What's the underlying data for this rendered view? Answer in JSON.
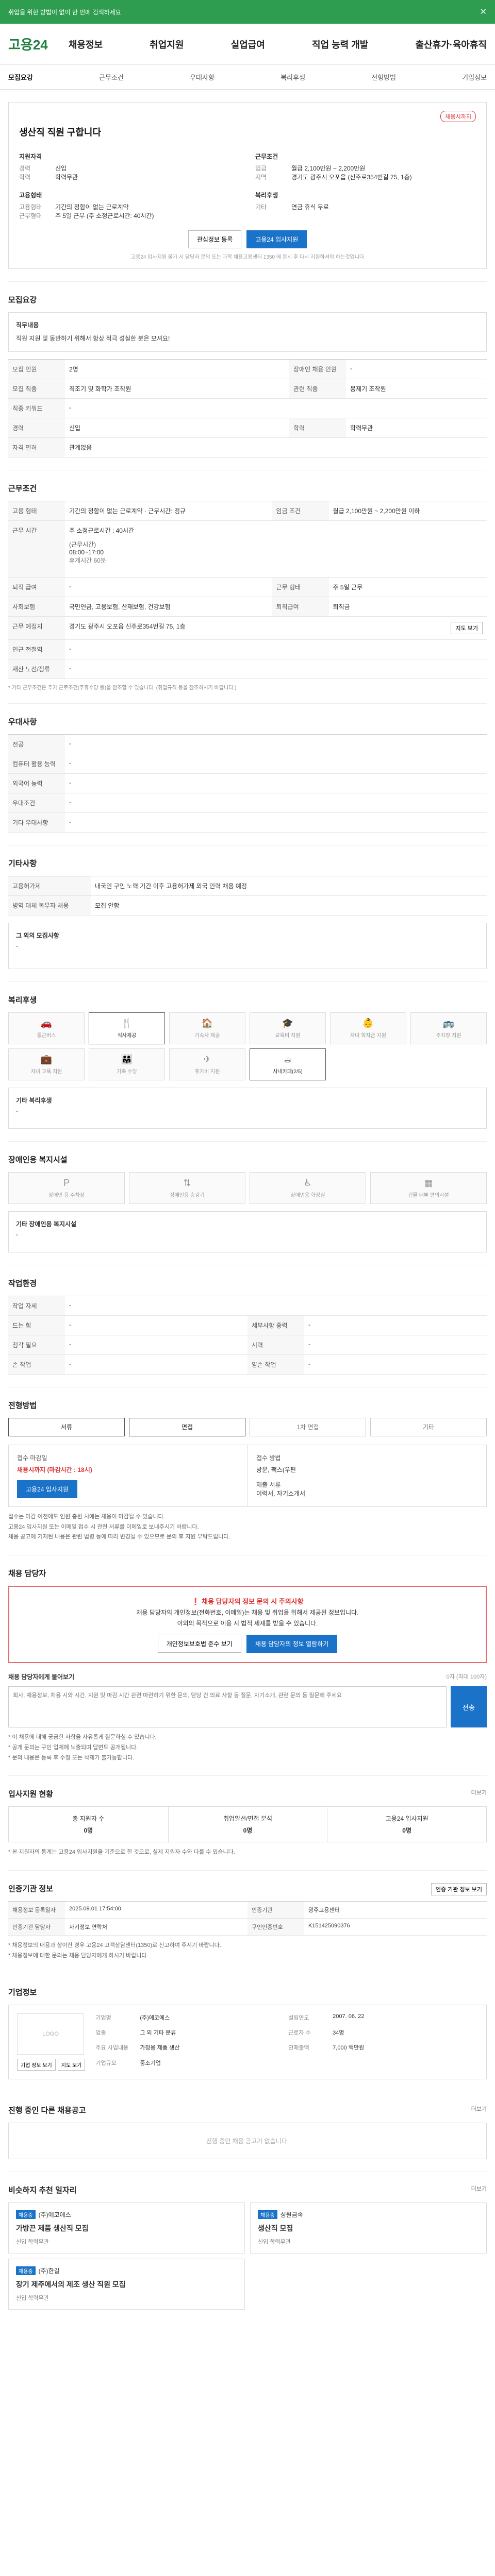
{
  "topbar": {
    "text": "취업을 위한 방법이 없이 한 번에 검색하세요",
    "close": "✕"
  },
  "header": {
    "logo": "고용24",
    "nav": [
      "채용정보",
      "취업지원",
      "실업급여",
      "직업 능력 개발",
      "출산휴가·육아휴직"
    ]
  },
  "subtabs": [
    "모집요강",
    "근무조건",
    "우대사항",
    "복리후생",
    "전형방법",
    "기업정보"
  ],
  "summary": {
    "badge": "채용시까지",
    "title": "생산직 직원 구합니다",
    "left_title": "지원자격",
    "right_title": "근무조건",
    "left": [
      [
        "경력",
        "신입"
      ],
      [
        "학력",
        "학력무관"
      ]
    ],
    "right": [
      [
        "임금",
        "월급 2,100만원 ~ 2,200만원"
      ],
      [
        "지역",
        "경기도 광주시 오포읍 (신주로354번길 75, 1층)"
      ]
    ],
    "extra_left_title": "고용형태",
    "extra_left": [
      [
        "고용형태",
        "기간의 정함이 없는 근로계약"
      ],
      [
        "근무형태",
        "주 5일 근무 (주 소정근로시간: 40시간)"
      ]
    ],
    "extra_right_title": "복리후생",
    "extra_right": [
      [
        "기타",
        "연금 휴식 무료"
      ]
    ],
    "btn_save": "관심정보 등록",
    "btn_apply": "고용24 입사지원",
    "note": "고용24 입사지원 불가 시 담당자 문의 또는 과학 채용고용센터 1350 에 응시 후 다시 지원하셔야 하는것입니다"
  },
  "recruit": {
    "title": "모집요강",
    "desc_label": "직무내용",
    "desc": "직원 지원 및 동반하기 위해서 항상 적극 성실한 분은 모셔요!",
    "rows": [
      [
        "모집 인원",
        "2명",
        "장애인 채용 인원",
        "-"
      ],
      [
        "모집 직종",
        "직조기 및 화학가 조작원",
        "관련 직종",
        "봉제기 조작원"
      ],
      [
        "직종 키워드",
        "-",
        "",
        ""
      ],
      [
        "경력",
        "신입",
        "학력",
        "학력무관"
      ],
      [
        "자격 면허",
        "관계없음",
        "",
        ""
      ]
    ]
  },
  "conditions": {
    "title": "근무조건",
    "rows": [
      [
        "고용 형태",
        "기간의 정함이 없는 근로계약 · 근무시간: 정규",
        "임금 조건",
        "월급 2,100만원 ~ 2,200만원 이하"
      ],
      [
        "근무 예정지",
        "경기 광주시 오포읍 신주로354번길 75, 1층",
        "",
        ""
      ],
      [
        "퇴직 급여",
        "-",
        "근무 형태",
        "주 5일 근무"
      ],
      [
        "사회보험",
        "국민연금, 고용보험, 산재보험, 건강보험",
        "퇴직급여",
        "퇴직금"
      ],
      [
        "근무 예정지",
        "경기도 광주시 오포읍 신주로354번길 75, 1층",
        "",
        ""
      ],
      [
        "인근 전철역",
        "-",
        "",
        ""
      ],
      [
        "재산 노선/정류",
        "-",
        "",
        ""
      ]
    ],
    "work_time_label": "근무 시간",
    "work_time": "주 소정근로시간 : 40시간",
    "work_detail_title": "(근무시간)",
    "work_detail": "08:00~17:00",
    "work_note": "휴게시간 60분",
    "map_btn": "지도 보기",
    "footnote": "* 기타 근무조건은 추가 근로조건(주휴수당 등)을 참조할 수 있습니다. (취업규칙 등을 참조하시기 바랍니다.)"
  },
  "prefer": {
    "title": "우대사항",
    "rows": [
      [
        "전공",
        "-"
      ],
      [
        "컴퓨터 활용 능력",
        "-"
      ],
      [
        "외국어 능력",
        "-"
      ],
      [
        "우대조건",
        "-"
      ],
      [
        "기타 우대사항",
        "-"
      ]
    ]
  },
  "other": {
    "title": "기타사항",
    "rows": [
      [
        "고용허가제",
        "내국인 구인 노력 기간 이후 고용허가제 외국 인력 채용 예정"
      ],
      [
        "병역 대체 복무자 채용",
        "모집 안함"
      ]
    ],
    "extra_label": "그 외의 모집사항",
    "extra_value": "-"
  },
  "welfare": {
    "title": "복리후생",
    "items": [
      {
        "icon": "🚗",
        "label": "통근버스",
        "on": false
      },
      {
        "icon": "🍴",
        "label": "식사제공",
        "on": true
      },
      {
        "icon": "🏠",
        "label": "기숙사 제공",
        "on": false
      },
      {
        "icon": "🎓",
        "label": "교육비 지원",
        "on": false
      },
      {
        "icon": "👶",
        "label": "자녀 학자금 지원",
        "on": false
      },
      {
        "icon": "🚌",
        "label": "주차장 지원",
        "on": false
      },
      {
        "icon": "💼",
        "label": "자녀 교육 지원",
        "on": false
      },
      {
        "icon": "👨‍👩‍👧",
        "label": "가족 수당",
        "on": false
      },
      {
        "icon": "✈",
        "label": "휴가비 지원",
        "on": false
      },
      {
        "icon": "☕",
        "label": "사내카페(2/5)",
        "on": true
      }
    ],
    "other_label": "기타 복리후생",
    "other_value": "-"
  },
  "disability": {
    "title": "장애인용 복지시설",
    "items": [
      "장애인 용 주차장",
      "장애인용 승강기",
      "장애인용 화장실",
      "건물 내부 편의시설"
    ],
    "other_label": "기타 장애인용 복지시설",
    "other_value": "-"
  },
  "workplace": {
    "title": "작업환경",
    "rows": [
      [
        "작업 자세",
        "-",
        "",
        ""
      ],
      [
        "드는 힘",
        "-",
        "세부사항 중력",
        "-"
      ],
      [
        "청각 필요",
        "-",
        "시력",
        "-"
      ],
      [
        "손 작업",
        "-",
        "양손 작업",
        "-"
      ]
    ]
  },
  "process": {
    "title": "전형방법",
    "steps": [
      {
        "label": "서류",
        "on": true
      },
      {
        "label": "면접",
        "on": true
      },
      {
        "label": "1차 면접",
        "on": false
      },
      {
        "label": "기타",
        "on": false
      }
    ]
  },
  "apply": {
    "deadline_label": "접수 마감일",
    "deadline": "채용시까지 (마감시간 : 18시)",
    "apply_btn": "고용24 입사지원",
    "method_label": "접수 방법",
    "method": "방문, 팩스(우편",
    "docs_label": "제출 서류",
    "docs": "이력서, 자기소개서",
    "notes": [
      "접수는 마감 이전에도 인원 충원 시에는 채용이 마감될 수 있습니다.",
      "고용24 입사지원 또는 이메일 접수 시 관련 서류를 이메일로 보내주시기 바랍니다.",
      "채용 공고에 기재된 내용은 관련 법령 등에 따라 변경될 수 있으므로 문의 후 지원 부탁드립니다."
    ]
  },
  "manager": {
    "title": "채용 담당자",
    "warn_head": "채용 담당자의 정보 문의 시 주의사항",
    "warn_body": "채용 담당자의 개인정보(전화번호, 이메일)는 채용 및 취업을 위해서 제공된 정보입니다.",
    "warn_body2": "이외의 목적으로 이용 시 법적 제재를 받을 수 있습니다.",
    "btn1": "개인정보보호법 준수 보기",
    "btn2": "채용 담당자의 정보 열람하기",
    "qna_label": "채용 담당자에게 물어보기",
    "qna_hint": "0자 (최대 100자)",
    "qna_placeholder": "회사, 채용정보, 채용 시와 시간, 지원 및 마감 시간 관련 마련하기 위한 문의, 담당 건 의료 사항 등 질문, 자기소개, 관련 문의 등 질문해 주세요",
    "send_btn": "전송",
    "bullets": [
      "* 이 채용에 대해 궁금한 사항을 자유롭게 질문하실 수 있습니다.",
      "* 공개 문의는 구인 업체에 노출되며 답변도 공개됩니다.",
      "* 문의 내용은 등록 후 수정 또는 삭제가 불가능합니다."
    ]
  },
  "status": {
    "title": "입사지원 현황",
    "more": "더보기",
    "cells": [
      {
        "label": "총 지원자 수",
        "value": "0명"
      },
      {
        "label": "취업알선/면접 분석",
        "value": "0명"
      },
      {
        "label": "고용24 입사지원",
        "value": "0명"
      }
    ],
    "note": "* 본 지원자의 통계는 고용24 입사지원을 기준으로 한 것으로, 실제 지원자 수와 다를 수 있습니다."
  },
  "info": {
    "title": "인증기관 정보",
    "btn": "인증 기관 정보 보기",
    "rows": [
      [
        "채용정보 등록일자",
        "2025.09.01 17:54:00",
        "인증기관",
        "광주고용센터"
      ],
      [
        "인증기관 담당자",
        "자기정보 연락처",
        "구인인증번호",
        "K151425090376"
      ]
    ],
    "notes": [
      "* 채용정보의 내용과 상이한 경우 고용24 고객상담센터(1350)로 신고하여 주시기 바랍니다.",
      "* 채용정보에 대한 문의는 채용 담당자에게 하시기 바랍니다."
    ]
  },
  "company": {
    "title": "기업정보",
    "logo": "LOGO",
    "rows": [
      [
        "기업명",
        "(주)에코에스",
        "설립연도",
        "2007. 06. 22"
      ],
      [
        "업종",
        "그 외 기타 분류",
        "근로자 수",
        "34명"
      ],
      [
        "주요 사업내용",
        "가정용 제품 생산",
        "연매출액",
        "7,000 백만원"
      ],
      [
        "기업규모",
        "중소기업",
        "",
        ""
      ]
    ],
    "btn_info": "기업 정보 보기",
    "btn_map": "지도 보기"
  },
  "ongoing": {
    "title": "진행 중인 다른 채용공고",
    "more": "더보기",
    "empty": "진행 중인 채용 공고가 없습니다."
  },
  "similar": {
    "title": "비슷하지 추천 일자리",
    "more": "더보기",
    "items": [
      {
        "tag": "채용중",
        "company": "(주)에코에스",
        "title": "가방끈 제품 생산직 모집",
        "meta": "신입  학력무관"
      },
      {
        "tag": "채용중",
        "company": "성원금속",
        "title": "생산직 모집",
        "meta": "신입  학력무관"
      },
      {
        "tag": "채용중",
        "company": "(주)한길",
        "title": "장기 제주에서의 제조 생산 직원 모집",
        "meta": "신입  학력무관"
      }
    ]
  },
  "colors": {
    "primary": "#1a73c8",
    "topbar": "#2e9d4f",
    "logo": "#1e7f3f",
    "alert": "#d33333"
  }
}
